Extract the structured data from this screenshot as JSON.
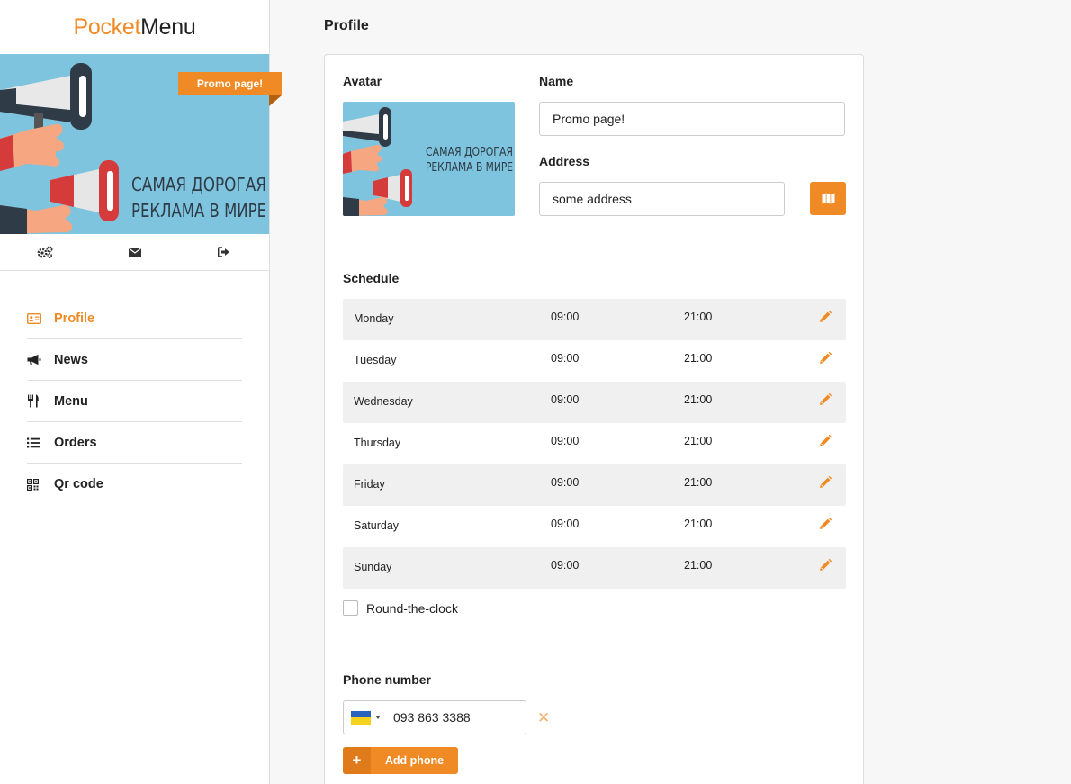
{
  "app": {
    "logo_part1": "Pocket",
    "logo_part2": "Menu"
  },
  "banner": {
    "ribbon": "Promo page!",
    "line1": "САМАЯ ДОРОГАЯ",
    "line2": "РЕКЛАМА В МИРЕ",
    "background_color": "#7ec4de"
  },
  "toolbar_icons": [
    "settings-icon",
    "envelope-icon",
    "sign-out-icon"
  ],
  "nav": {
    "items": [
      {
        "label": "Profile",
        "icon": "id-card-icon",
        "active": true
      },
      {
        "label": "News",
        "icon": "megaphone-icon",
        "active": false
      },
      {
        "label": "Menu",
        "icon": "cutlery-icon",
        "active": false
      },
      {
        "label": "Orders",
        "icon": "list-icon",
        "active": false
      },
      {
        "label": "Qr code",
        "icon": "qrcode-icon",
        "active": false
      }
    ]
  },
  "page": {
    "title": "Profile"
  },
  "form": {
    "avatar_label": "Avatar",
    "name_label": "Name",
    "name_value": "Promo page!",
    "address_label": "Address",
    "address_value": "some address",
    "map_button_icon": "map-icon",
    "schedule_label": "Schedule",
    "schedule": [
      {
        "day": "Monday",
        "from": "09:00",
        "to": "21:00"
      },
      {
        "day": "Tuesday",
        "from": "09:00",
        "to": "21:00"
      },
      {
        "day": "Wednesday",
        "from": "09:00",
        "to": "21:00"
      },
      {
        "day": "Thursday",
        "from": "09:00",
        "to": "21:00"
      },
      {
        "day": "Friday",
        "from": "09:00",
        "to": "21:00"
      },
      {
        "day": "Saturday",
        "from": "09:00",
        "to": "21:00"
      },
      {
        "day": "Sunday",
        "from": "09:00",
        "to": "21:00"
      }
    ],
    "round_clock_label": "Round-the-clock",
    "round_clock_checked": false,
    "phone_label": "Phone number",
    "phone_value": "093 863 3388",
    "phone_country": "Ukraine",
    "remove_icon": "close-icon",
    "add_phone_label": "Add phone",
    "add_phone_symbol": "+"
  },
  "colors": {
    "accent": "#f08a24",
    "text": "#222222",
    "row_shade": "#f0f0f0",
    "flag_blue": "#2a62c0",
    "flag_yellow": "#f5d21c"
  }
}
